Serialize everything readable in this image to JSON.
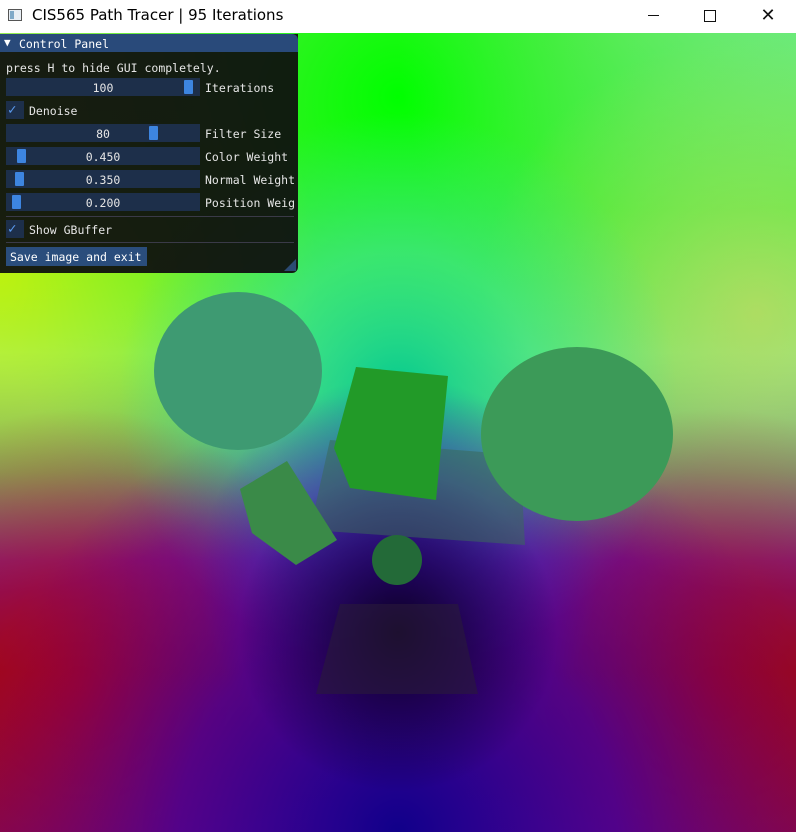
{
  "window": {
    "title": "CIS565 Path Tracer | 95 Iterations",
    "minimize_icon": "minimize-icon",
    "maximize_icon": "maximize-icon",
    "close_icon": "close-icon",
    "close_glyph": "✕"
  },
  "panel": {
    "title": "Control Panel",
    "arrow_glyph": "▼",
    "hint": "press H to hide GUI completely.",
    "iterations": {
      "value": "100",
      "label": "Iterations",
      "level": 0.97
    },
    "denoise": {
      "label": "Denoise",
      "checked": true,
      "check_glyph": "✓"
    },
    "filter_size": {
      "value": "80",
      "label": "Filter Size",
      "level": 0.78
    },
    "color_weight": {
      "value": "0.450",
      "label": "Color Weight",
      "level": 0.05
    },
    "normal_weight": {
      "value": "0.350",
      "label": "Normal Weight",
      "level": 0.04
    },
    "position_weight": {
      "value": "0.200",
      "label": "Position Weig",
      "level": 0.02
    },
    "show_gbuffer": {
      "label": "Show GBuffer",
      "checked": true,
      "check_glyph": "✓"
    },
    "save_button": "Save image and exit"
  },
  "colors": {
    "header": "#294a7a",
    "slider_bg": "#1d2f4a",
    "slider_grab": "#3d85e0",
    "button_bg": "#2a4d7c",
    "check": "#5b9bee"
  }
}
